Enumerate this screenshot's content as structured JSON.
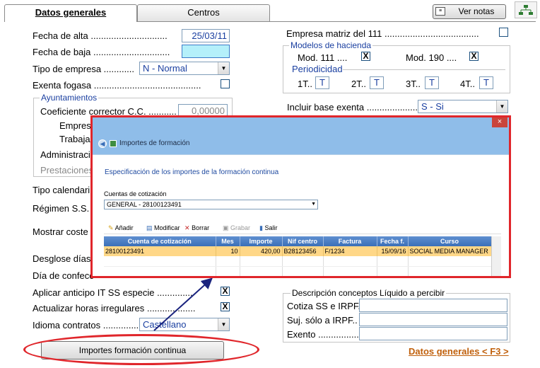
{
  "tabs": [
    {
      "label": "Datos generales"
    },
    {
      "label": "Centros"
    }
  ],
  "top_buttons": {
    "ver_notas": "Ver notas"
  },
  "left": {
    "fecha_alta_label": "Fecha de alta ..............................",
    "fecha_alta_value": "25/03/11",
    "fecha_baja_label": "Fecha de baja ..............................",
    "fecha_baja_value": "",
    "tipo_empresa_label": "Tipo de empresa ............",
    "tipo_empresa_value": "N - Normal",
    "exenta_fogasa_label": "Exenta fogasa ..........................................",
    "ayuntamientos_title": "Ayuntamientos",
    "coef_label": "Coeficiente corrector C.C. ...........",
    "coef_value": "0,00000",
    "empres_label": "Empres",
    "trabaja_label": "Trabaja",
    "administraci_label": "Administraci",
    "prestaciones_label": "Prestaciones",
    "tipo_calendario_label": "Tipo calendari",
    "regimen_label": "Régimen S.S.",
    "mostrar_coste_label": "Mostrar coste",
    "desglose_label": "Desglose días",
    "dia_confecc_label": "Día de confecc",
    "anticipo_label": "Aplicar anticipo IT SS especie ..............",
    "horas_label": "Actualizar horas irregulares ...................",
    "idioma_label": "Idioma contratos ...................",
    "idioma_value": "Castellano",
    "importes_button": "Importes formación continua"
  },
  "right": {
    "empresa_matriz_label": "Empresa matriz del 111 .....................................",
    "modelos_title": "Modelos de hacienda",
    "mod111_label": "Mod. 111 ....",
    "mod190_label": "Mod. 190 ....",
    "periodicidad_label": "Periodicidad",
    "p1_label": "1T..",
    "p2_label": "2T..",
    "p3_label": "3T..",
    "p4_label": "4T..",
    "p_value": "T",
    "incluir_label": "Incluir base exenta ....................",
    "incluir_value": "S - Si",
    "descripcion_title": "Descripción conceptos Líquido a percibir",
    "cotiza_label": "Cotiza SS e IRPF.",
    "suj_label": "Suj. sólo a IRPF..",
    "exento_label": "Exento ................",
    "datos_link": "Datos generales < F3 >"
  },
  "checkbox_mark": "X",
  "modal": {
    "title": "Importes de formación",
    "close": "×",
    "heading": "Especificación de los importes de la formación continua",
    "cuentas_label": "Cuentas de cotización",
    "cuentas_value": "GENERAL - 28100123491",
    "toolbar": {
      "anadir": "Añadir",
      "modificar": "Modificar",
      "borrar": "Borrar",
      "grabar": "Grabar",
      "salir": "Salir"
    },
    "columns": [
      "Cuenta de cotización",
      "Mes",
      "Importe",
      "Nif centro",
      "Factura",
      "Fecha f.",
      "Curso"
    ],
    "rows": [
      [
        "28100123491",
        "10",
        "420,00",
        "B28123456",
        "F/1234",
        "15/09/16",
        "SOCIAL MEDIA MANAGER"
      ]
    ]
  },
  "colors": {
    "accent_red": "#e0262b",
    "header_blue": "#8fbde9",
    "selected_row": "#ffd787",
    "link_orange": "#c0600c"
  }
}
